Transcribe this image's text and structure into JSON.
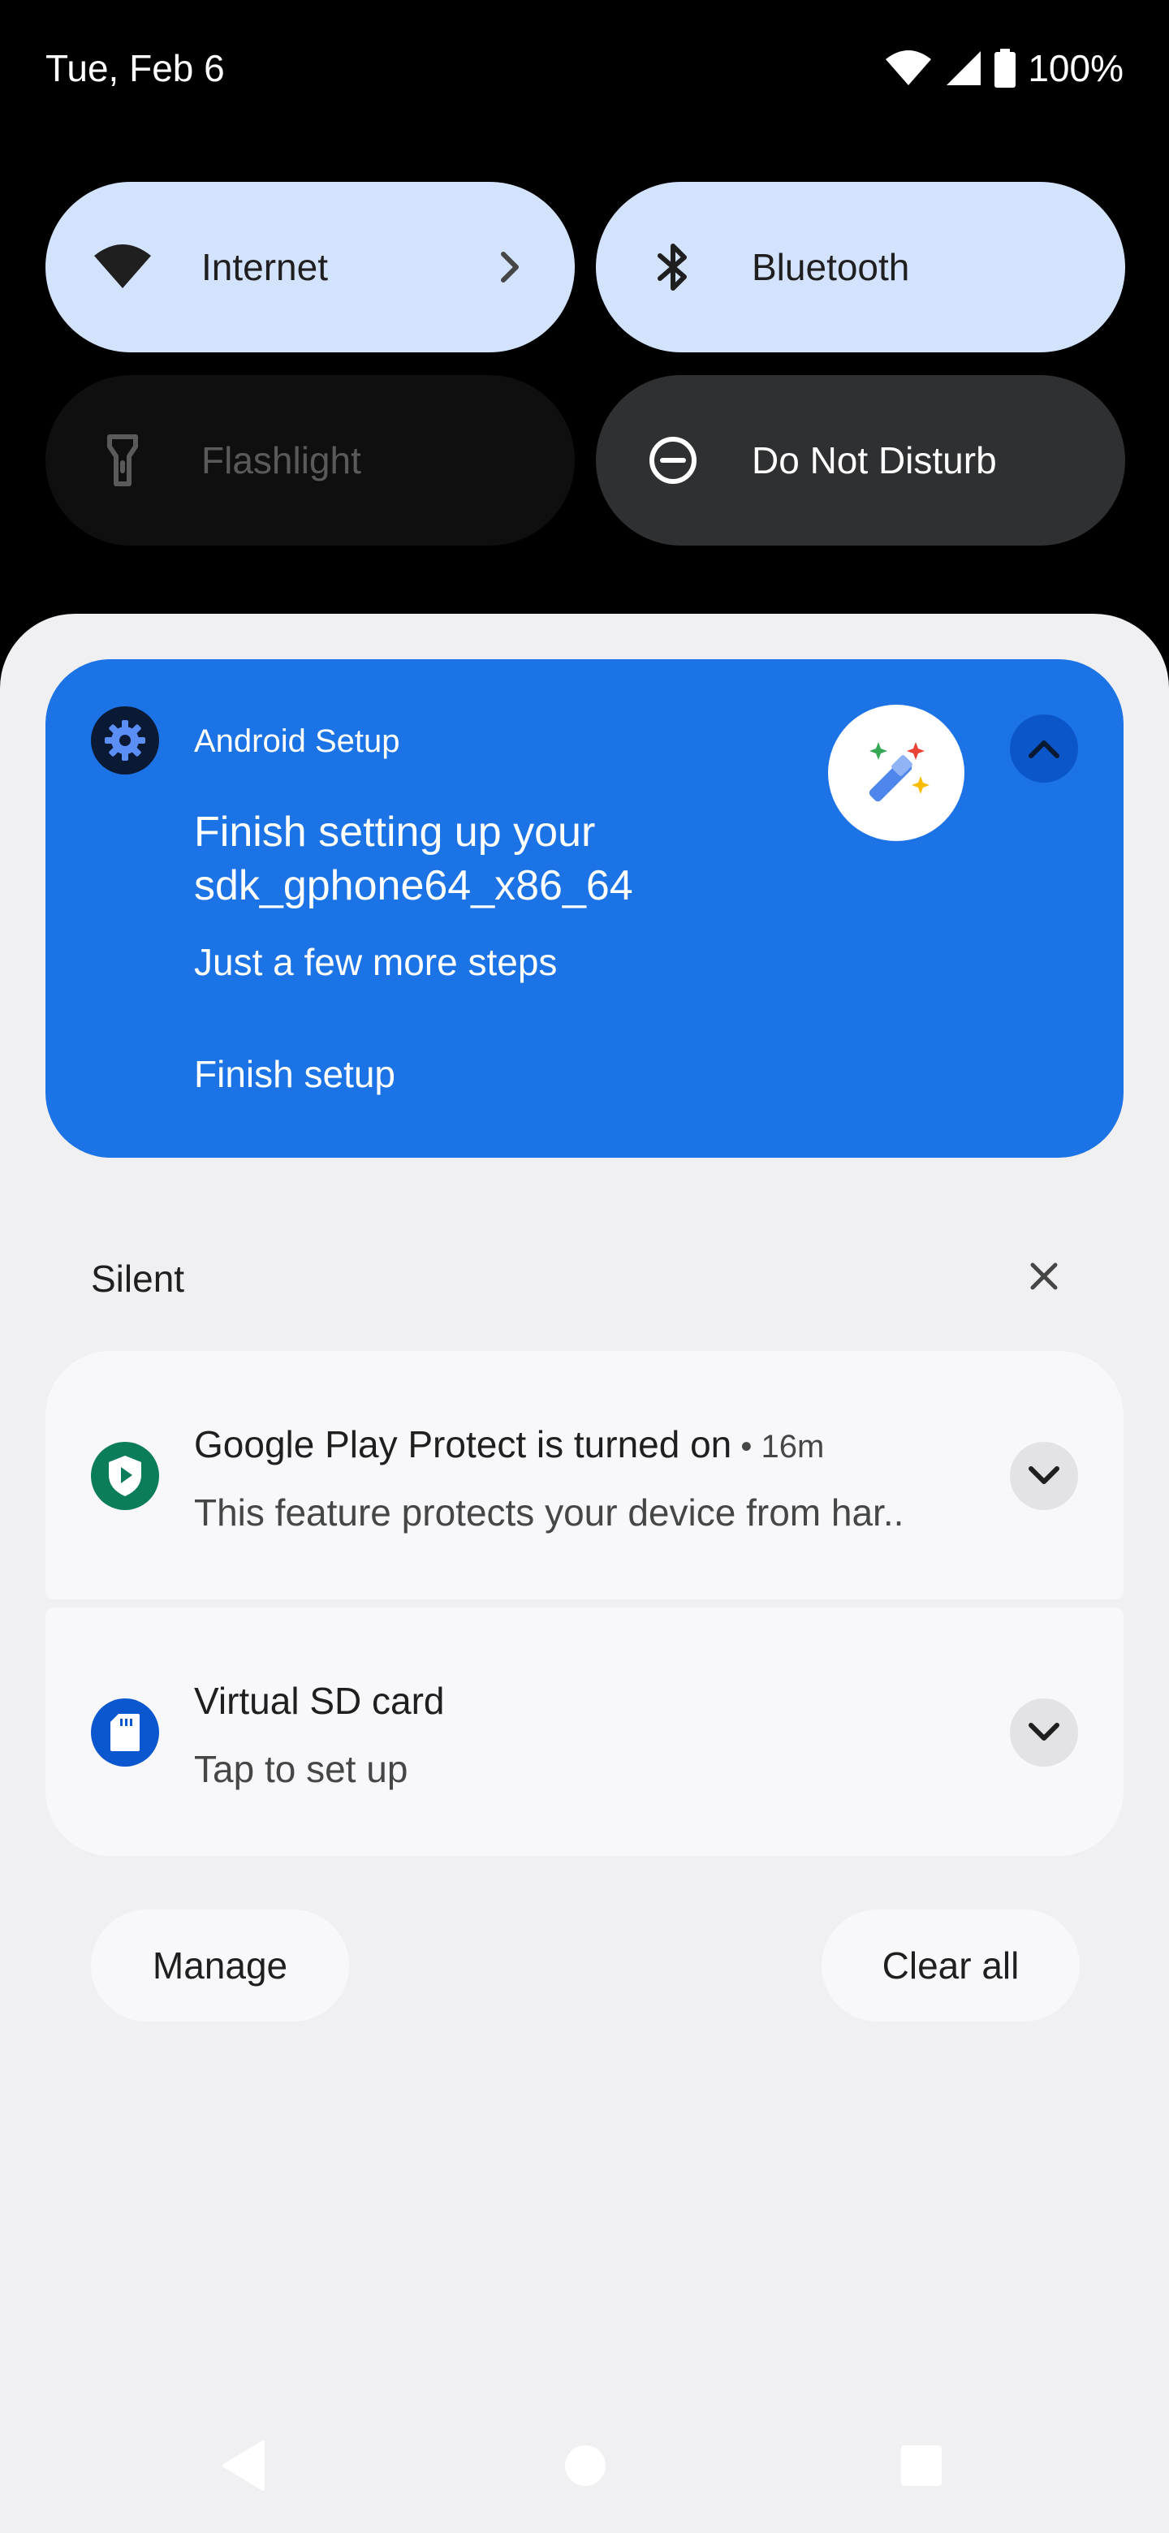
{
  "status_bar": {
    "date": "Tue, Feb 6",
    "battery": "100%",
    "icons": [
      "wifi-icon",
      "signal-icon",
      "battery-icon"
    ]
  },
  "quick_settings": {
    "tiles": [
      {
        "label": "Internet",
        "icon": "wifi-icon",
        "state": "on",
        "has_chevron": true
      },
      {
        "label": "Bluetooth",
        "icon": "bluetooth-icon",
        "state": "on"
      },
      {
        "label": "Flashlight",
        "icon": "flashlight-icon",
        "state": "unavailable"
      },
      {
        "label": "Do Not Disturb",
        "icon": "do-not-disturb-icon",
        "state": "off"
      }
    ]
  },
  "setup_notification": {
    "app_name": "Android Setup",
    "title": "Finish setting up your sdk_gphone64_x86_64",
    "subtitle": "Just a few more steps",
    "action": "Finish setup",
    "icon": "gear-icon",
    "large_icon": "magic-wand-icon",
    "color": "#1b73e6"
  },
  "silent_section": {
    "label": "Silent",
    "notifications": [
      {
        "title": "Google Play Protect is turned on",
        "time": "16m",
        "text": "This feature protects your device from har..",
        "icon": "play-protect-icon",
        "icon_color": "#0b7d5a"
      },
      {
        "title": "Virtual SD card",
        "text": "Tap to set up",
        "icon": "sd-card-icon",
        "icon_color": "#0b57d0"
      }
    ]
  },
  "footer": {
    "manage_label": "Manage",
    "clear_all_label": "Clear all"
  },
  "navigation": {
    "buttons": [
      "back-button",
      "home-button",
      "recents-button"
    ]
  },
  "colors": {
    "tile_on": "#d3e3fd",
    "tile_dark": "#2e3032",
    "shade_background": "#f0f0f3"
  }
}
